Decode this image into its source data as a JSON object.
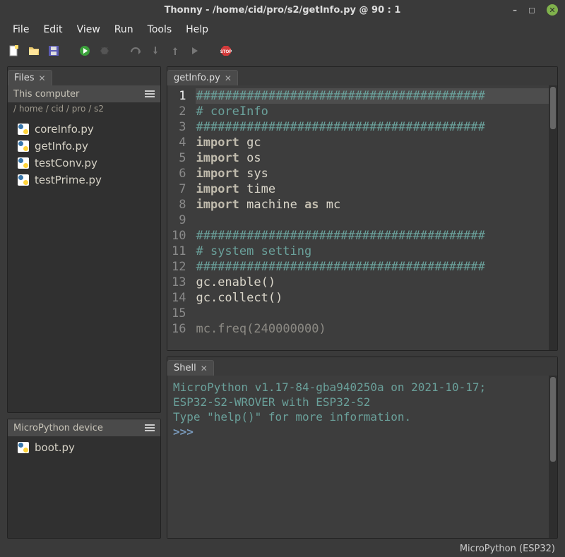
{
  "window": {
    "title": "Thonny  -  /home/cid/pro/s2/getInfo.py  @  90 : 1"
  },
  "menubar": [
    "File",
    "Edit",
    "View",
    "Run",
    "Tools",
    "Help"
  ],
  "files_panel": {
    "tab": "Files",
    "header": "This computer",
    "breadcrumb": "/ home / cid / pro / s2",
    "items": [
      "coreInfo.py",
      "getInfo.py",
      "testConv.py",
      "testPrime.py"
    ]
  },
  "mpy_panel": {
    "header": "MicroPython device",
    "items": [
      "boot.py"
    ]
  },
  "editor": {
    "tab": "getInfo.py",
    "lines": [
      {
        "n": 1,
        "t": "comment",
        "text": "########################################"
      },
      {
        "n": 2,
        "t": "comment",
        "text": "# coreInfo"
      },
      {
        "n": 3,
        "t": "comment",
        "text": "########################################"
      },
      {
        "n": 4,
        "t": "import",
        "kw1": "import",
        "mod": "gc"
      },
      {
        "n": 5,
        "t": "import",
        "kw1": "import",
        "mod": "os"
      },
      {
        "n": 6,
        "t": "import",
        "kw1": "import",
        "mod": "sys"
      },
      {
        "n": 7,
        "t": "import",
        "kw1": "import",
        "mod": "time"
      },
      {
        "n": 8,
        "t": "importas",
        "kw1": "import",
        "mod": "machine",
        "kw2": "as",
        "alias": "mc"
      },
      {
        "n": 9,
        "t": "blank",
        "text": ""
      },
      {
        "n": 10,
        "t": "comment",
        "text": "########################################"
      },
      {
        "n": 11,
        "t": "comment",
        "text": "# system setting"
      },
      {
        "n": 12,
        "t": "comment",
        "text": "########################################"
      },
      {
        "n": 13,
        "t": "plain",
        "text": "gc.enable()"
      },
      {
        "n": 14,
        "t": "plain",
        "text": "gc.collect()"
      },
      {
        "n": 15,
        "t": "blank",
        "text": ""
      },
      {
        "n": 16,
        "t": "call",
        "fn": "mc.freq",
        "arg": "240000000",
        "cut": true
      }
    ]
  },
  "shell": {
    "tab": "Shell",
    "lines": [
      "MicroPython v1.17-84-gba940250a on 2021-10-17;",
      "ESP32-S2-WROVER with ESP32-S2",
      "Type \"help()\" for more information."
    ],
    "prompt": ">>> "
  },
  "status": {
    "interpreter": "MicroPython (ESP32)"
  }
}
